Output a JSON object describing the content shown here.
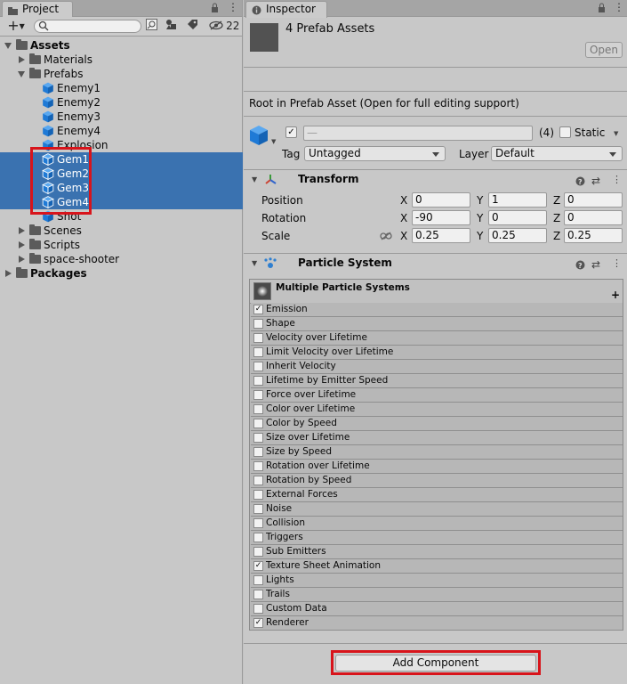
{
  "project": {
    "tab_label": "Project",
    "add_label": "+",
    "hidden_count": "22",
    "search_placeholder": "",
    "tree": [
      {
        "label": "Assets",
        "kind": "folder",
        "indent": 0,
        "expanded": true,
        "bold": true
      },
      {
        "label": "Materials",
        "kind": "folder",
        "indent": 1,
        "expanded": false
      },
      {
        "label": "Prefabs",
        "kind": "folder",
        "indent": 1,
        "expanded": true
      },
      {
        "label": "Enemy1",
        "kind": "prefab",
        "indent": 2
      },
      {
        "label": "Enemy2",
        "kind": "prefab",
        "indent": 2
      },
      {
        "label": "Enemy3",
        "kind": "prefab",
        "indent": 2
      },
      {
        "label": "Enemy4",
        "kind": "prefab",
        "indent": 2
      },
      {
        "label": "Explosion",
        "kind": "prefab",
        "indent": 2
      },
      {
        "label": "Gem1",
        "kind": "prefab",
        "indent": 2,
        "selected": true
      },
      {
        "label": "Gem2",
        "kind": "prefab",
        "indent": 2,
        "selected": true
      },
      {
        "label": "Gem3",
        "kind": "prefab",
        "indent": 2,
        "selected": true
      },
      {
        "label": "Gem4",
        "kind": "prefab",
        "indent": 2,
        "selected": true
      },
      {
        "label": "Shot",
        "kind": "prefab",
        "indent": 2
      },
      {
        "label": "Scenes",
        "kind": "folder",
        "indent": 1,
        "expanded": false
      },
      {
        "label": "Scripts",
        "kind": "folder",
        "indent": 1,
        "expanded": false
      },
      {
        "label": "space-shooter",
        "kind": "folder",
        "indent": 1,
        "expanded": false
      },
      {
        "label": "Packages",
        "kind": "folder",
        "indent": 0,
        "expanded": false,
        "bold": true
      }
    ]
  },
  "inspector": {
    "tab_label": "Inspector",
    "title": "4 Prefab Assets",
    "open_button": "Open",
    "notice": "Root in Prefab Asset (Open for full editing support)",
    "name_value": "—",
    "name_count": "(4)",
    "static_label": "Static",
    "tag_label": "Tag",
    "tag_value": "Untagged",
    "layer_label": "Layer",
    "layer_value": "Default",
    "transform": {
      "title": "Transform",
      "position_label": "Position",
      "rotation_label": "Rotation",
      "scale_label": "Scale",
      "axis_x": "X",
      "axis_y": "Y",
      "axis_z": "Z",
      "position": [
        "0",
        "1",
        "0"
      ],
      "rotation": [
        "-90",
        "0",
        "0"
      ],
      "scale": [
        "0.25",
        "0.25",
        "0.25"
      ]
    },
    "particle_system": {
      "title": "Particle System",
      "header": "Multiple Particle Systems",
      "plus": "+",
      "modules": [
        {
          "label": "Emission",
          "checked": true
        },
        {
          "label": "Shape",
          "checked": false
        },
        {
          "label": "Velocity over Lifetime",
          "checked": false
        },
        {
          "label": "Limit Velocity over Lifetime",
          "checked": false
        },
        {
          "label": "Inherit Velocity",
          "checked": false
        },
        {
          "label": "Lifetime by Emitter Speed",
          "checked": false
        },
        {
          "label": "Force over Lifetime",
          "checked": false
        },
        {
          "label": "Color over Lifetime",
          "checked": false
        },
        {
          "label": "Color by Speed",
          "checked": false
        },
        {
          "label": "Size over Lifetime",
          "checked": false
        },
        {
          "label": "Size by Speed",
          "checked": false
        },
        {
          "label": "Rotation over Lifetime",
          "checked": false
        },
        {
          "label": "Rotation by Speed",
          "checked": false
        },
        {
          "label": "External Forces",
          "checked": false
        },
        {
          "label": "Noise",
          "checked": false
        },
        {
          "label": "Collision",
          "checked": false
        },
        {
          "label": "Triggers",
          "checked": false
        },
        {
          "label": "Sub Emitters",
          "checked": false
        },
        {
          "label": "Texture Sheet Animation",
          "checked": true
        },
        {
          "label": "Lights",
          "checked": false
        },
        {
          "label": "Trails",
          "checked": false
        },
        {
          "label": "Custom Data",
          "checked": false
        },
        {
          "label": "Renderer",
          "checked": true
        }
      ]
    },
    "add_component": "Add Component"
  },
  "colors": {
    "selection": "#3a72b0",
    "highlight_box": "#d8141b",
    "prefab_icon": "#1f7ad6"
  },
  "icons": [
    "folder-icon",
    "lock-icon",
    "menu-icon",
    "prefab-cube-icon",
    "help-icon",
    "settings-icon",
    "more-icon",
    "transform-icon",
    "particle-icon",
    "eye-slash-icon",
    "search-icon",
    "link-icon"
  ]
}
